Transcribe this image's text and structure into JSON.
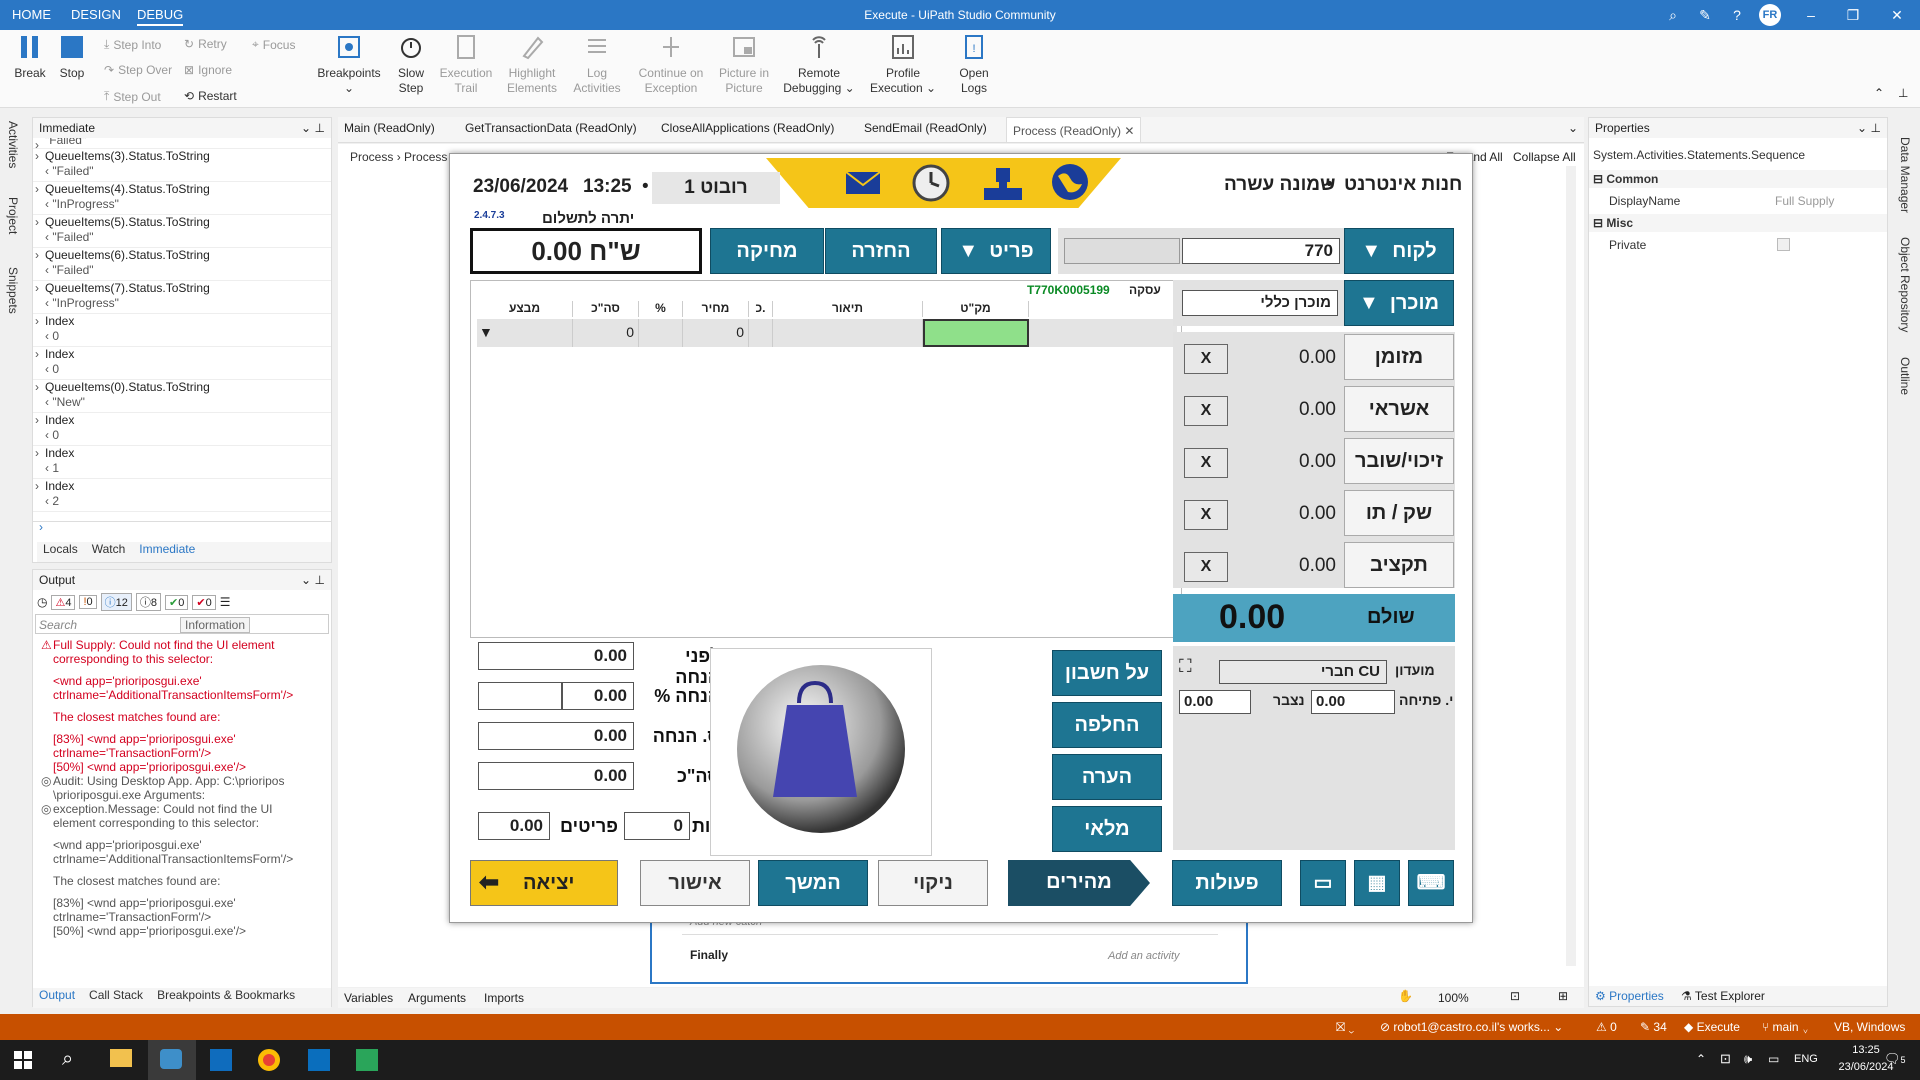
{
  "titlebar": {
    "tabs": [
      "HOME",
      "DESIGN",
      "DEBUG"
    ],
    "title": "Execute - UiPath Studio Community",
    "user": "FR"
  },
  "ribbon": {
    "break": "Break",
    "stop": "Stop",
    "step_into": "Step Into",
    "step_over": "Step Over",
    "step_out": "Step Out",
    "retry": "Retry",
    "ignore": "Ignore",
    "restart": "Restart",
    "focus": "Focus",
    "breakpoints": "Breakpoints",
    "slow_step": [
      "Slow",
      "Step"
    ],
    "execution_trail": [
      "Execution",
      "Trail"
    ],
    "highlight_elements": [
      "Highlight",
      "Elements"
    ],
    "log_activities": [
      "Log",
      "Activities"
    ],
    "continue_on_exception": [
      "Continue on",
      "Exception"
    ],
    "picture_in_picture": [
      "Picture in",
      "Picture"
    ],
    "remote_debugging": [
      "Remote",
      "Debugging"
    ],
    "profile_execution": [
      "Profile",
      "Execution"
    ],
    "open_logs": [
      "Open",
      "Logs"
    ]
  },
  "leftrail": [
    "Activities",
    "Project",
    "Snippets"
  ],
  "rightrail": [
    "Data Manager",
    "Object Repository",
    "Outline"
  ],
  "immediate": {
    "title": "Immediate",
    "items": [
      {
        "expr": "\"Failed\"",
        "val": ""
      },
      {
        "expr": "QueueItems(3).Status.ToString",
        "val": "\"Failed\""
      },
      {
        "expr": "QueueItems(4).Status.ToString",
        "val": "\"InProgress\""
      },
      {
        "expr": "QueueItems(5).Status.ToString",
        "val": "\"Failed\""
      },
      {
        "expr": "QueueItems(6).Status.ToString",
        "val": "\"Failed\""
      },
      {
        "expr": "QueueItems(7).Status.ToString",
        "val": "\"InProgress\""
      },
      {
        "expr": "Index",
        "val": "0"
      },
      {
        "expr": "Index",
        "val": "0"
      },
      {
        "expr": "QueueItems(0).Status.ToString",
        "val": "\"New\""
      },
      {
        "expr": "Index",
        "val": "0"
      },
      {
        "expr": "Index",
        "val": "1"
      },
      {
        "expr": "Index",
        "val": "2"
      }
    ],
    "tabs": [
      "Locals",
      "Watch",
      "Immediate"
    ]
  },
  "output": {
    "title": "Output",
    "filters": [
      "4",
      "0",
      "12",
      "8",
      "0",
      "0"
    ],
    "search_placeholder": "Search",
    "tooltip": "Information",
    "lines": [
      {
        "t": "Full Supply: Could not find the UI element",
        "c": "err",
        "icon": "⚠"
      },
      {
        "t": "corresponding to this selector:",
        "c": "err"
      },
      {
        "t": "",
        "c": "err"
      },
      {
        "t": "<wnd app='prioriposgui.exe'",
        "c": "err"
      },
      {
        "t": "ctrlname='AdditionalTransactionItemsForm'/>",
        "c": "err"
      },
      {
        "t": "",
        "c": "err"
      },
      {
        "t": "The closest matches found are:",
        "c": "err"
      },
      {
        "t": "",
        "c": "err"
      },
      {
        "t": "[83%] <wnd app='prioriposgui.exe'",
        "c": "err"
      },
      {
        "t": "ctrlname='TransactionForm'/>",
        "c": "err"
      },
      {
        "t": "[50%] <wnd app='prioriposgui.exe'/>",
        "c": "err"
      },
      {
        "t": "Audit: Using Desktop App. App: C:\\prioripos",
        "c": "norm",
        "icon": "◎"
      },
      {
        "t": "\\prioriposgui.exe Arguments:",
        "c": "norm"
      },
      {
        "t": "exception.Message: Could not find the UI",
        "c": "norm",
        "icon": "◎"
      },
      {
        "t": "element corresponding to this selector:",
        "c": "norm"
      },
      {
        "t": "",
        "c": "norm"
      },
      {
        "t": "<wnd app='prioriposgui.exe'",
        "c": "norm"
      },
      {
        "t": "ctrlname='AdditionalTransactionItemsForm'/>",
        "c": "norm"
      },
      {
        "t": "",
        "c": "norm"
      },
      {
        "t": "The closest matches found are:",
        "c": "norm"
      },
      {
        "t": "",
        "c": "norm"
      },
      {
        "t": "[83%] <wnd app='prioriposgui.exe'",
        "c": "norm"
      },
      {
        "t": "ctrlname='TransactionForm'/>",
        "c": "norm"
      },
      {
        "t": "[50%] <wnd app='prioriposgui.exe'/>",
        "c": "norm"
      }
    ],
    "tabs": [
      "Output",
      "Call Stack",
      "Breakpoints & Bookmarks"
    ]
  },
  "doc_tabs": [
    "Main (ReadOnly)",
    "GetTransactionData (ReadOnly)",
    "CloseAllApplications (ReadOnly)",
    "SendEmail (ReadOnly)",
    "Process (ReadOnly)"
  ],
  "designer": {
    "breadcrumb": [
      "Process",
      "Process"
    ],
    "expand_all": "Expand All",
    "collapse_all": "Collapse All",
    "add_new_catch": "Add new catch",
    "finally": "Finally",
    "add_activity": "Add an activity",
    "bottom_tabs": [
      "Variables",
      "Arguments",
      "Imports"
    ],
    "zoom": "100%"
  },
  "properties": {
    "title": "Properties",
    "type": "System.Activities.Statements.Sequence",
    "common": "Common",
    "display_name_label": "DisplayName",
    "display_name_value": "Full Supply",
    "misc": "Misc",
    "private_label": "Private",
    "tabs": [
      "Properties",
      "Test Explorer"
    ]
  },
  "pos": {
    "store": "חנות אינטרנט",
    "shift": "שמונה עשרה",
    "date": "23/06/2024",
    "time": "13:25",
    "robot": "רובוט 1",
    "version": "2.4.7.3",
    "balance_label": "יתרה לתשלום",
    "balance": "0.00 ש\"ח",
    "btn_delete": "מחיקה",
    "btn_return": "החזרה",
    "btn_item": "פריט",
    "btn_customer": "לקוח",
    "customer_value": "770",
    "btn_seller": "מוכרן",
    "seller_value": "מוכרן כללי",
    "transaction_label": "עסקה",
    "transaction_id": "T770K0005199",
    "grid_headers": [
      "מבצע",
      "סה\"כ",
      "%",
      "מחיר",
      "כ.",
      "תיאור",
      "מק\"ט"
    ],
    "grid_row": [
      "",
      "0",
      "",
      "0",
      "",
      "",
      ""
    ],
    "payments": [
      {
        "label": "מזומן",
        "amount": "0.00"
      },
      {
        "label": "אשראי",
        "amount": "0.00"
      },
      {
        "label": "זיכוי/שובר",
        "amount": "0.00"
      },
      {
        "label": "שק / תו",
        "amount": "0.00"
      },
      {
        "label": "תקציב",
        "amount": "0.00"
      }
    ],
    "paid_label": "שולם",
    "paid": "0.00",
    "club_label": "מועדון",
    "club_value": "חברי CU",
    "opening_label": "י. פתיחה",
    "opening_value": "0.00",
    "accum_label": "נצבר",
    "accum_value": "0.00",
    "before_disc_label": "לפני הנחה",
    "before_disc": "0.00",
    "disc_pct_label": "% הנחה",
    "disc_pct": "0.00",
    "disc_sum_label": "ס. הנחה",
    "disc_sum": "0.00",
    "total_label": "סה\"כ",
    "total": "0.00",
    "rows_label": "שורות",
    "rows": "0",
    "items_label": "פריטים",
    "items": "0.00",
    "side_btns": [
      "על חשבון",
      "החלפה",
      "הערה",
      "מלאי"
    ],
    "btn_exit": "יציאה",
    "btn_approve": "אישור",
    "btn_continue": "המשך",
    "btn_clear": "ניקוי",
    "btn_quick": "מהירים",
    "btn_actions": "פעולות"
  },
  "statusbar": {
    "user": "robot1@castro.co.il's works...",
    "warn": "0",
    "changes": "34",
    "execute": "Execute",
    "branch": "main",
    "lang": "VB, Windows"
  },
  "taskbar": {
    "lang": "ENG",
    "time": "13:25",
    "date": "23/06/2024",
    "notif": "5"
  },
  "colors": {
    "accent": "#2b77c5",
    "status": "#c75000",
    "pos_teal": "#1e7592",
    "pos_yellow": "#f5c518"
  }
}
